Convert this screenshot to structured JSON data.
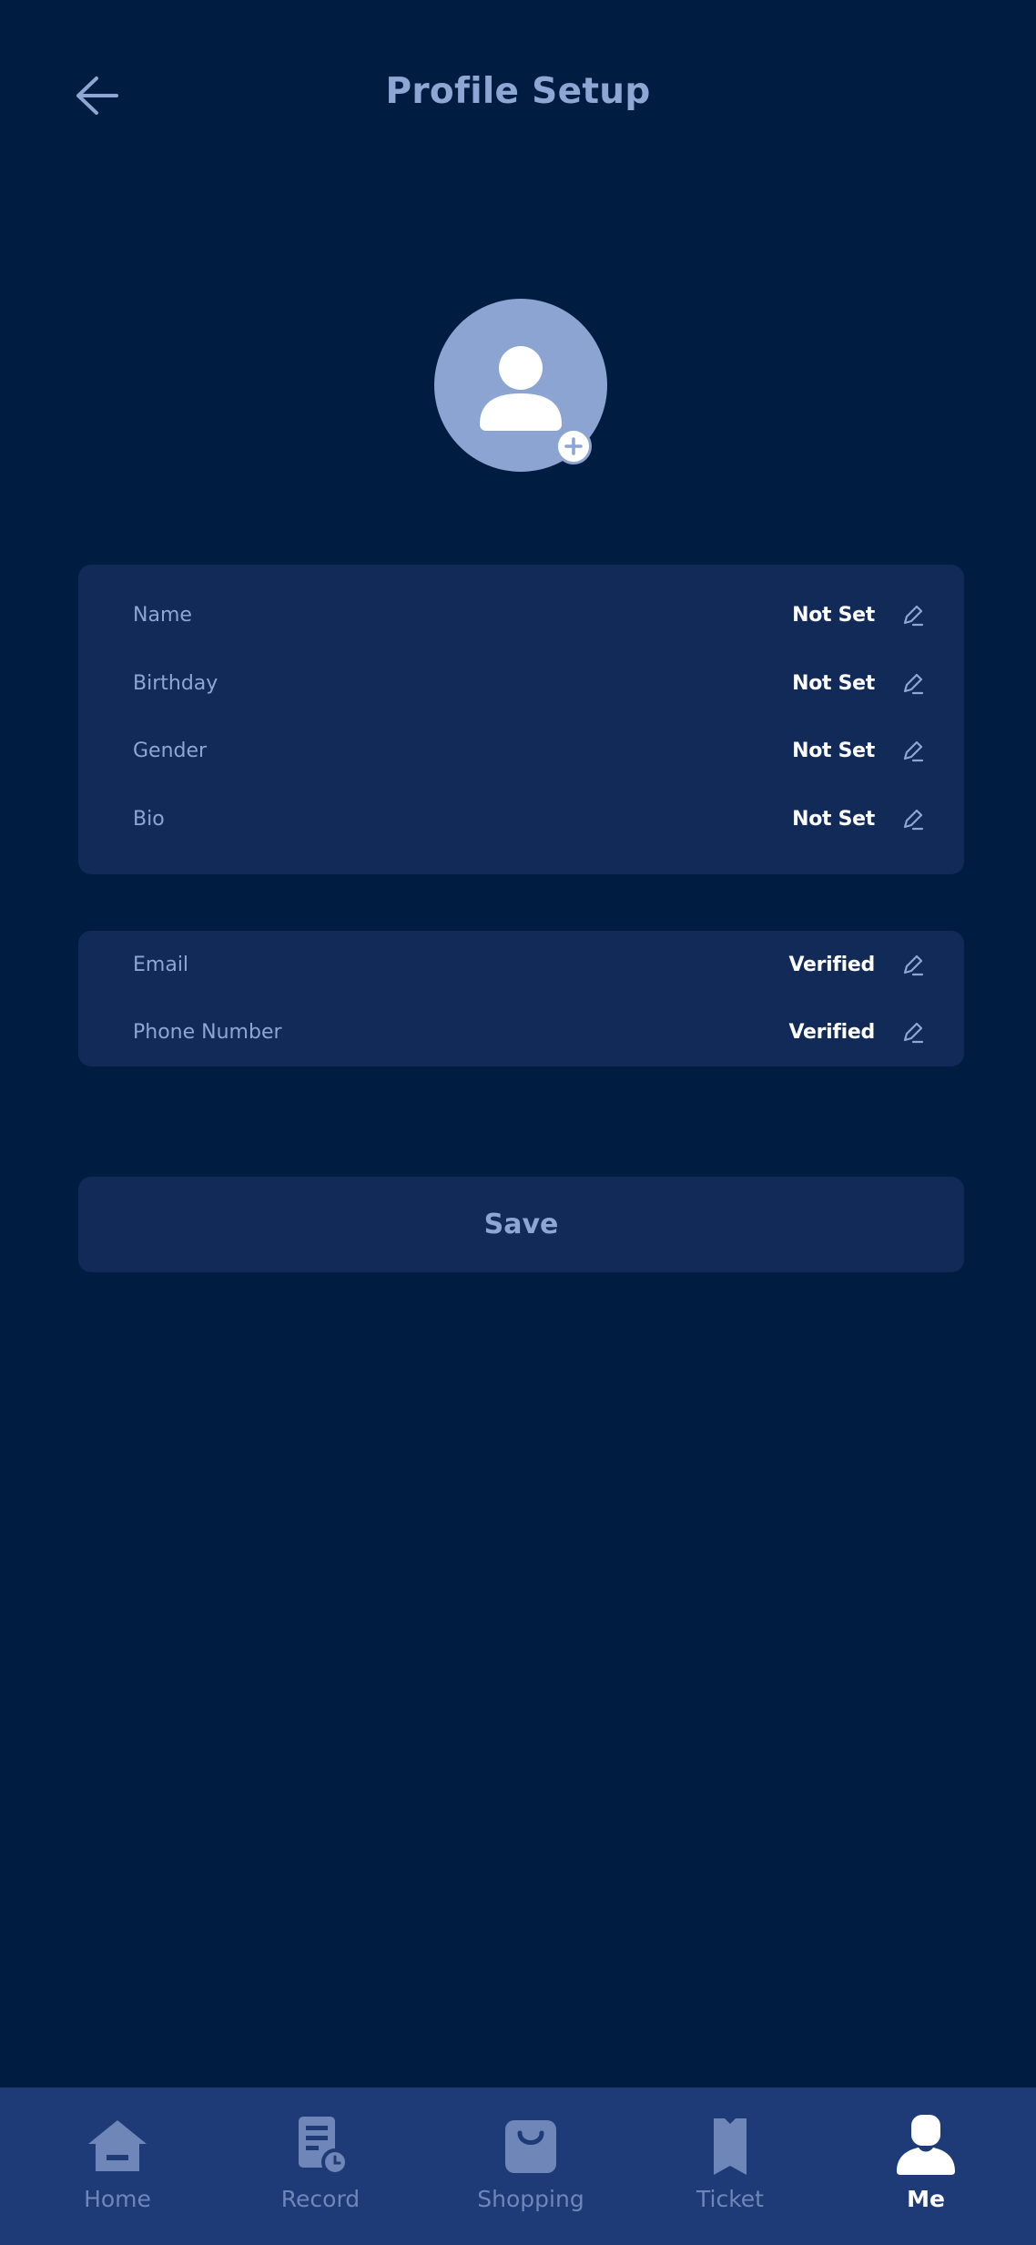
{
  "header": {
    "title": "Profile Setup",
    "back_icon": "arrow-left-icon"
  },
  "avatar": {
    "icon": "person-icon",
    "add_icon": "plus-circle-icon"
  },
  "profile_fields": [
    {
      "label": "Name",
      "value": "Not Set"
    },
    {
      "label": "Birthday",
      "value": "Not Set"
    },
    {
      "label": "Gender",
      "value": "Not Set"
    },
    {
      "label": "Bio",
      "value": "Not Set"
    }
  ],
  "contact_fields": [
    {
      "label": "Email",
      "value": "Verified"
    },
    {
      "label": "Phone Number",
      "value": "Verified"
    }
  ],
  "save_label": "Save",
  "nav": {
    "items": [
      {
        "label": "Home",
        "icon": "home-icon",
        "active": false
      },
      {
        "label": "Record",
        "icon": "record-icon",
        "active": false
      },
      {
        "label": "Shopping",
        "icon": "shopping-bag-icon",
        "active": false
      },
      {
        "label": "Ticket",
        "icon": "ticket-icon",
        "active": false
      },
      {
        "label": "Me",
        "icon": "person-icon",
        "active": true
      }
    ]
  },
  "colors": {
    "background": "#001c40",
    "card": "#112a57",
    "nav_background": "#1e3b78",
    "accent_text": "#8da6d3",
    "value_text": "#ffffff",
    "avatar": "#8ca4d2"
  }
}
